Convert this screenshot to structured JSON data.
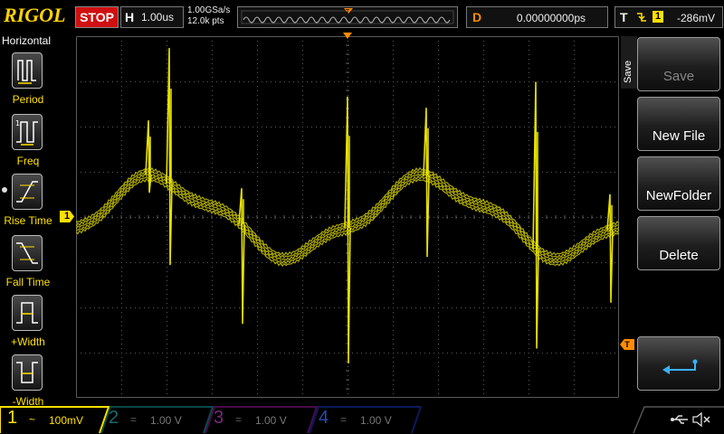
{
  "header": {
    "brand": "RIGOL",
    "run_state": "STOP",
    "timebase_label": "H",
    "timebase_value": "1.00us",
    "sample_rate": "1.00GSa/s",
    "memory_depth": "12.0k pts",
    "trigger_pos_marker": "T",
    "delay_label": "D",
    "delay_value": "0.00000000ps",
    "trigger_label": "T",
    "trigger_source": "1",
    "trigger_level": "-286mV"
  },
  "left_menu": {
    "title": "Horizontal",
    "items": [
      {
        "label": "Period",
        "icon": "period-icon"
      },
      {
        "label": "Freq",
        "icon": "frequency-icon"
      },
      {
        "label": "Rise Time",
        "icon": "rise-time-icon"
      },
      {
        "label": "Fall Time",
        "icon": "fall-time-icon"
      },
      {
        "label": "+Width",
        "icon": "positive-width-icon"
      },
      {
        "label": "-Width",
        "icon": "negative-width-icon"
      }
    ]
  },
  "right_menu": {
    "tab_label": "Save",
    "buttons": [
      {
        "label": "Save",
        "enabled": false
      },
      {
        "label": "New File",
        "enabled": true
      },
      {
        "label": "NewFolder",
        "enabled": true
      },
      {
        "label": "Delete",
        "enabled": true
      },
      {
        "label": "",
        "icon": "return-icon",
        "enabled": true
      }
    ]
  },
  "markers": {
    "ch1_ground": "1",
    "trigger_level_marker": "T"
  },
  "channels": [
    {
      "num": "1",
      "coupling": "~",
      "scale": "100mV",
      "color": "#ffe000",
      "active": true
    },
    {
      "num": "2",
      "coupling": "=",
      "scale": "1.00 V",
      "color": "#00a0a0",
      "active": false
    },
    {
      "num": "3",
      "coupling": "=",
      "scale": "1.00 V",
      "color": "#b000b0",
      "active": false
    },
    {
      "num": "4",
      "coupling": "=",
      "scale": "1.00 V",
      "color": "#2060ff",
      "active": false
    }
  ],
  "status_icons": [
    "usb-icon",
    "speaker-muted-icon"
  ],
  "colors": {
    "ch1": "#e6e000",
    "stop": "#d01010",
    "accent_orange": "#ff8c00",
    "grid": "#5a5a5a"
  }
}
